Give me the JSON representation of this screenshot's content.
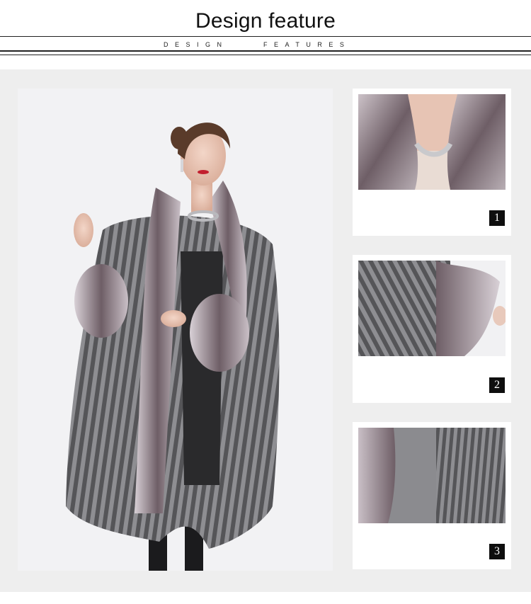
{
  "header": {
    "title": "Design feature",
    "subtitle_left": "DESIGN",
    "subtitle_right": "FEATURES"
  },
  "details": [
    {
      "number": "1",
      "image": "collar detail"
    },
    {
      "number": "2",
      "image": "sleeve cuff detail"
    },
    {
      "number": "3",
      "image": "hem detail"
    }
  ],
  "colors": {
    "panel_background": "#eeeeee",
    "badge_background": "#0e0e0e",
    "fur": "#6e5e66",
    "stripe_dark": "#555558",
    "stripe_light": "#8e8e92"
  }
}
